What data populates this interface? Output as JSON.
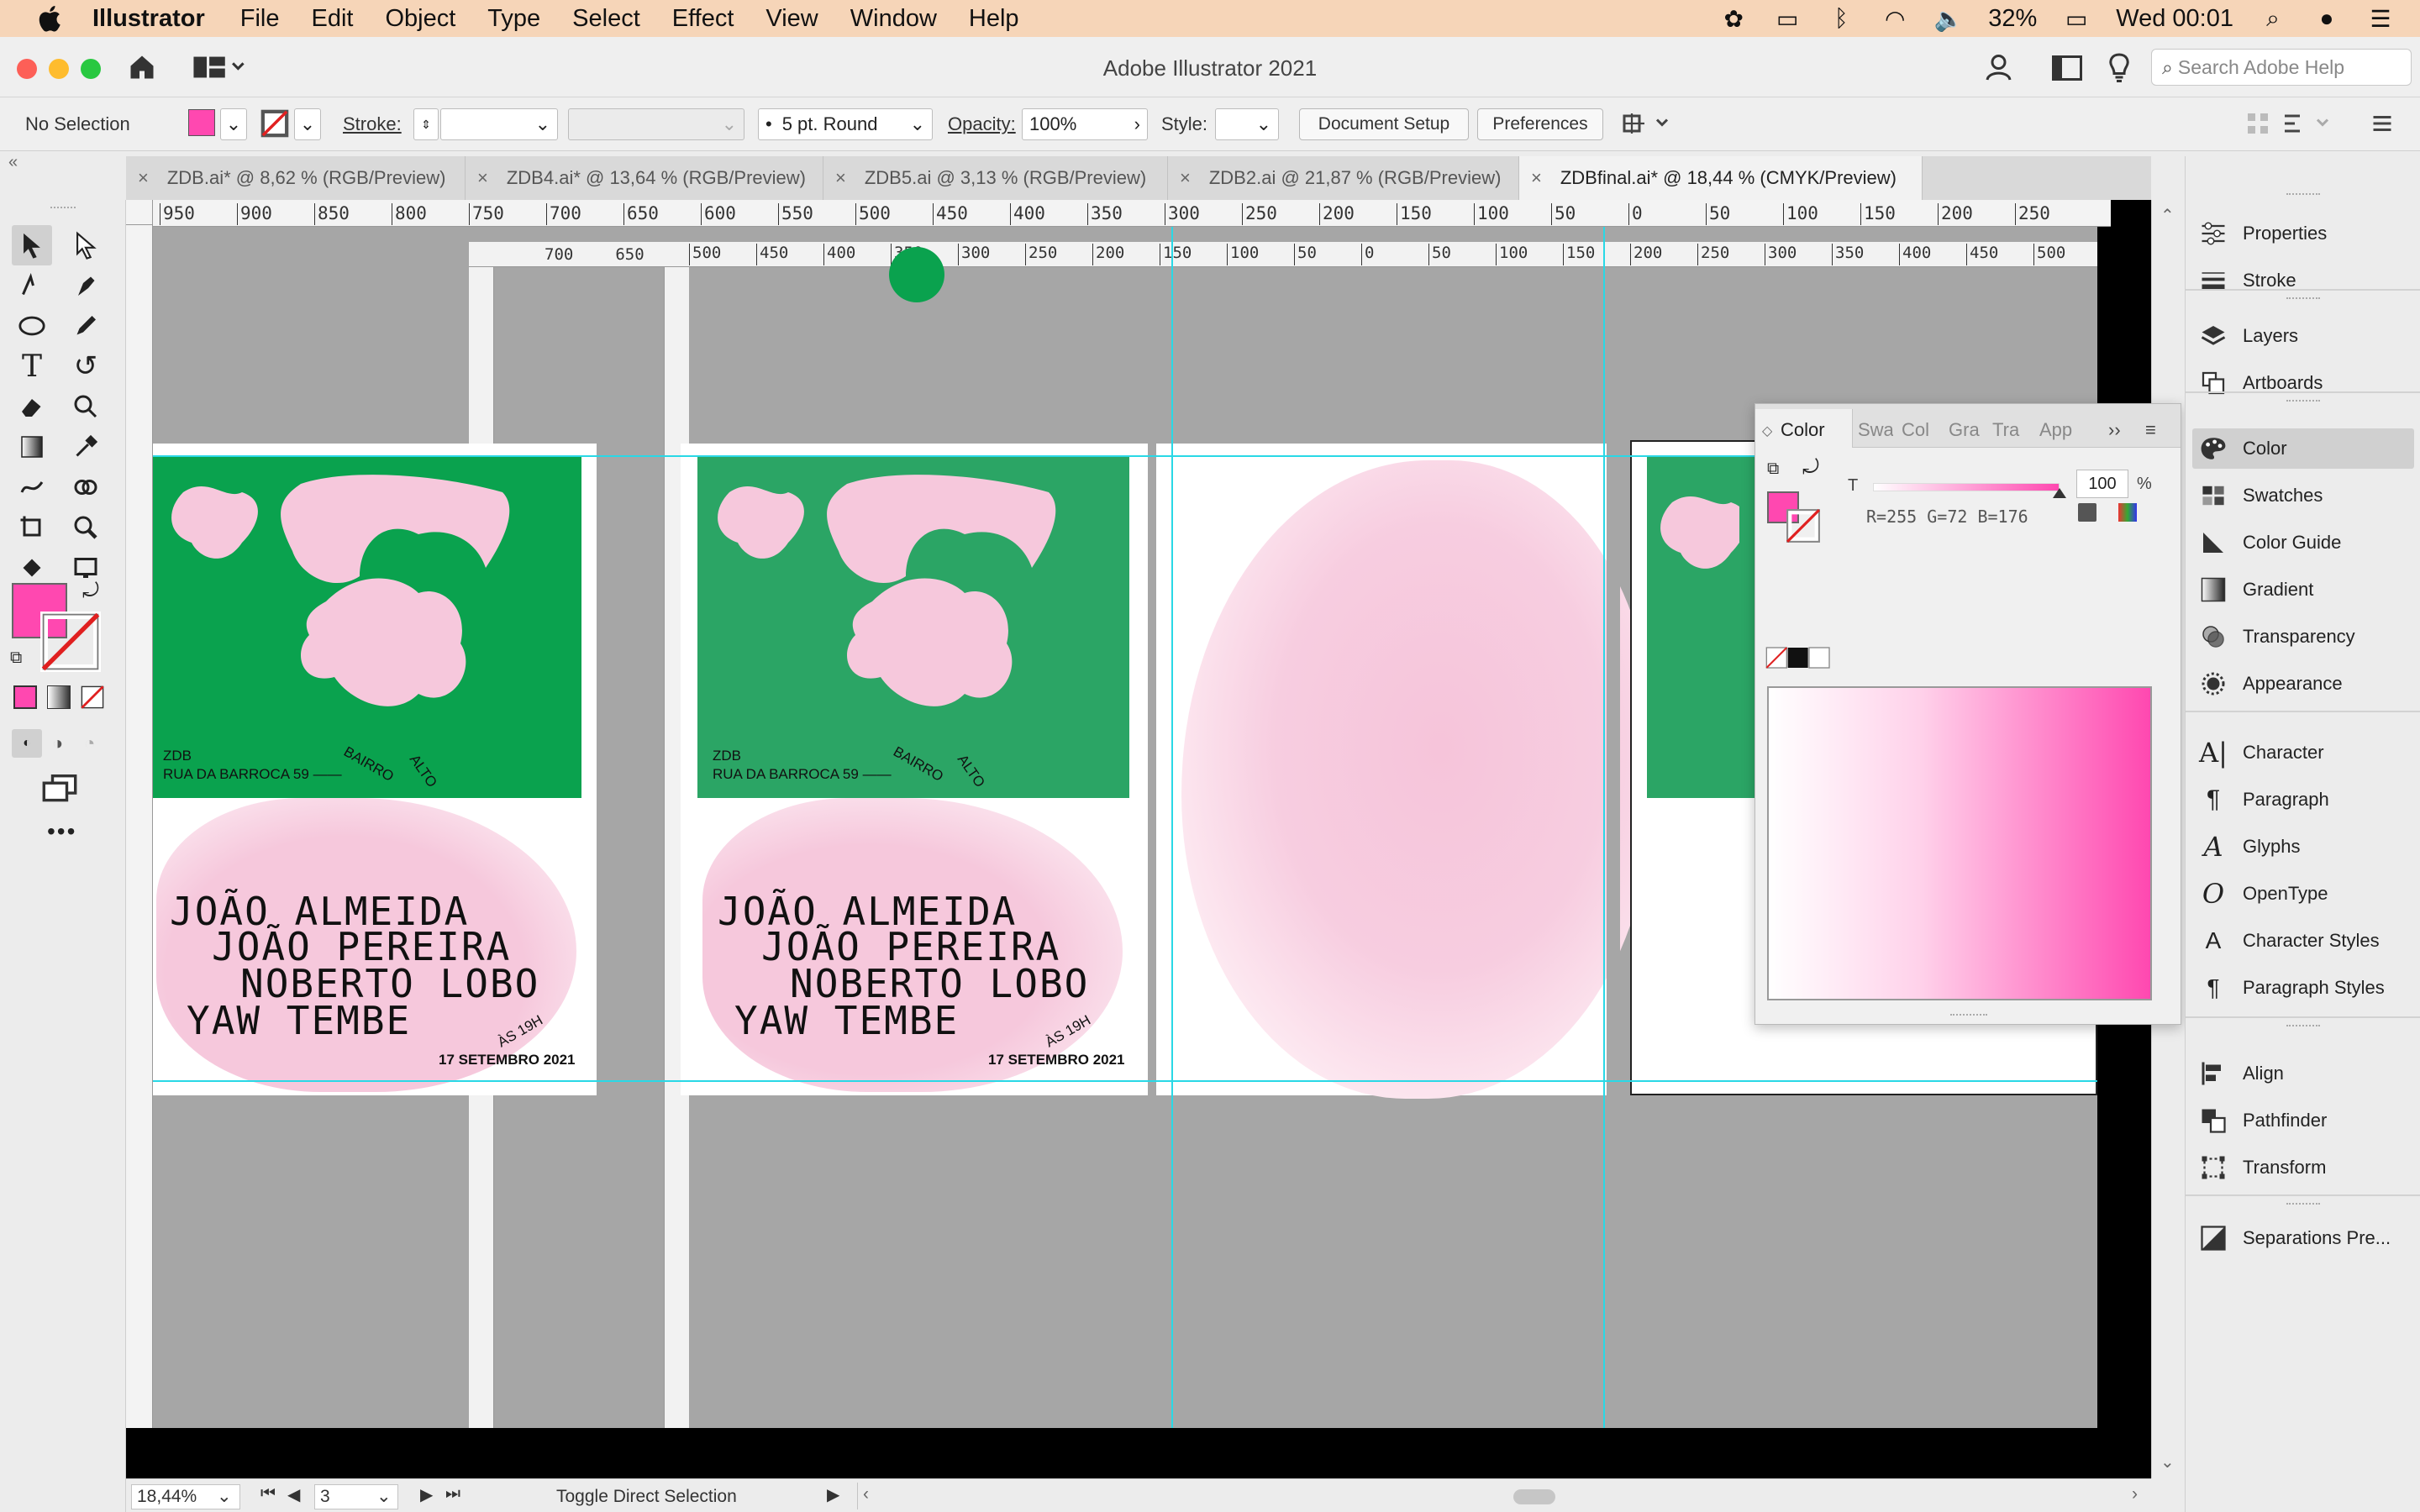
{
  "menubar": {
    "app_name": "Illustrator",
    "items": [
      "File",
      "Edit",
      "Object",
      "Type",
      "Select",
      "Effect",
      "View",
      "Window",
      "Help"
    ],
    "battery": "32%",
    "clock": "Wed 00:01",
    "bg_color": "#f6d5b8"
  },
  "window": {
    "title": "Adobe Illustrator 2021",
    "help_search_placeholder": "Search Adobe Help"
  },
  "control_bar": {
    "selection": "No Selection",
    "stroke_label": "Stroke:",
    "brush_label": "5 pt. Round",
    "opacity_label": "Opacity:",
    "opacity_value": "100%",
    "style_label": "Style:",
    "document_setup": "Document Setup",
    "preferences": "Preferences"
  },
  "doc_tabs": [
    {
      "label": "ZDB.ai* @ 8,62 % (RGB/Preview)",
      "active": false
    },
    {
      "label": "ZDB4.ai* @ 13,64 % (RGB/Preview)",
      "active": false
    },
    {
      "label": "ZDB5.ai @ 3,13 % (RGB/Preview)",
      "active": false
    },
    {
      "label": "ZDB2.ai @ 21,87 % (RGB/Preview)",
      "active": false
    },
    {
      "label": "ZDBfinal.ai* @ 18,44 % (CMYK/Preview)",
      "active": true
    }
  ],
  "rulers": {
    "top": [
      "950",
      "900",
      "850",
      "800",
      "750",
      "700",
      "650",
      "600",
      "550",
      "500",
      "450",
      "400",
      "350",
      "300",
      "250",
      "200",
      "150",
      "100",
      "50",
      "0",
      "50",
      "100",
      "150",
      "200",
      "250"
    ],
    "inner_left": [
      "700",
      "650"
    ],
    "inner_right": [
      "500",
      "450",
      "400",
      "350",
      "300",
      "250",
      "200",
      "150",
      "100",
      "50",
      "0",
      "50",
      "100",
      "150",
      "200",
      "250",
      "300",
      "350",
      "400",
      "450",
      "500"
    ]
  },
  "posters": [
    {
      "venue": "ZDB",
      "address": "RUA DA BARROCA 59 ——",
      "bairro": "BAIRRO",
      "alto": "ALTO",
      "names": [
        "JOÃO ALMEIDA",
        "JOÃO PEREIRA",
        "NOBERTO LOBO",
        "YAW TEMBE"
      ],
      "time": "ÀS 19H",
      "date": "17 SETEMBRO 2021"
    },
    {
      "venue": "ZDB",
      "address": "RUA DA BARROCA 59 ——",
      "bairro": "BAIRRO",
      "alto": "ALTO",
      "names": [
        "JOÃO ALMEIDA",
        "JOÃO PEREIRA",
        "NOBERTO LOBO",
        "YAW TEMBE"
      ],
      "time": "ÀS 19H",
      "date": "17 SETEMBRO 2021"
    }
  ],
  "poster_colors": {
    "green": "#0aa24e",
    "green2": "#2ba565",
    "pink": "#f6c8dc"
  },
  "color_panel": {
    "tabs": [
      "Color",
      "Swa",
      "Col",
      "Gra",
      "Tra",
      "App"
    ],
    "channel_label": "T",
    "tint_value": "100",
    "percent": "%",
    "readout": "R=255 G=72 B=176",
    "fill_color": "#ff48b0"
  },
  "dock_panels": [
    [
      "Properties",
      "Stroke"
    ],
    [
      "Layers",
      "Artboards"
    ],
    [
      "Color",
      "Swatches",
      "Color Guide",
      "Gradient",
      "Transparency",
      "Appearance"
    ],
    [
      "Character",
      "Paragraph",
      "Glyphs",
      "OpenType",
      "Character Styles",
      "Paragraph Styles"
    ],
    [
      "Align",
      "Pathfinder",
      "Transform"
    ],
    [
      "Separations Pre..."
    ]
  ],
  "status_bar": {
    "zoom": "18,44%",
    "artboard_number": "3",
    "tool_hint": "Toggle Direct Selection"
  }
}
